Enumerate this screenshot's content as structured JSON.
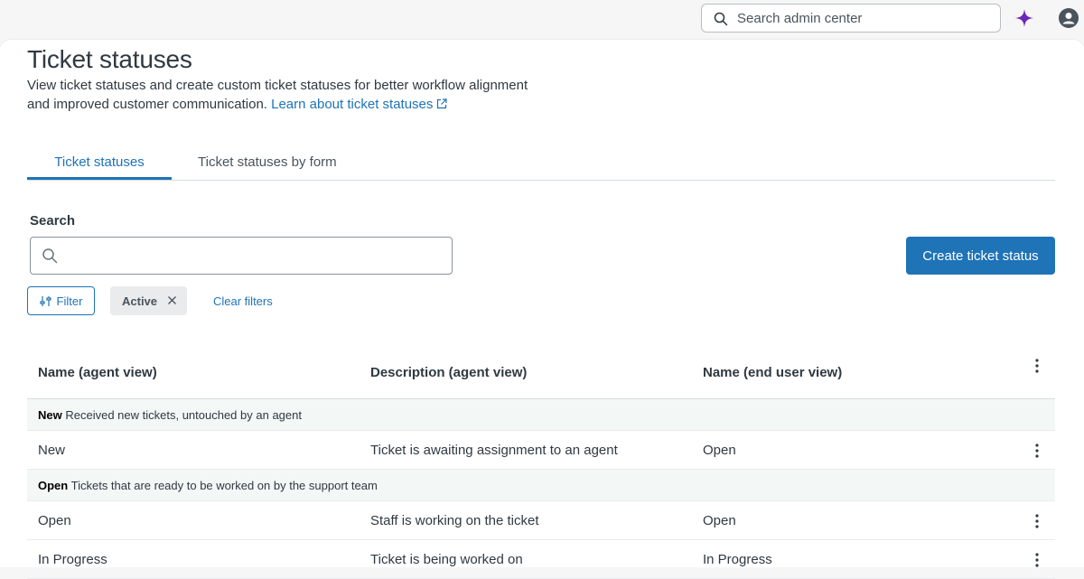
{
  "topbar": {
    "search_placeholder": "Search admin center",
    "icons": [
      "search-icon",
      "ai-sparkle-icon",
      "avatar-icon"
    ],
    "ai_color": "#6a27b8"
  },
  "page": {
    "title": "Ticket statuses",
    "description_line1": "View ticket statuses and create custom ticket statuses for better workflow alignment",
    "description_line2": "and improved customer communication.",
    "learn_link": "Learn about ticket statuses"
  },
  "tabs": [
    {
      "label": "Ticket statuses",
      "active": true
    },
    {
      "label": "Ticket statuses by form",
      "active": false
    }
  ],
  "search": {
    "label": "Search",
    "value": ""
  },
  "create_button": "Create ticket status",
  "filters": {
    "filter_label": "Filter",
    "active_chip": "Active",
    "clear_label": "Clear filters"
  },
  "table": {
    "headers": [
      "Name (agent view)",
      "Description (agent view)",
      "Name (end user view)"
    ],
    "groups": [
      {
        "name": "New",
        "description": "Received new tickets, untouched by an agent",
        "rows": [
          {
            "name": "New",
            "description": "Ticket is awaiting assignment to an agent",
            "end_user": "Open"
          }
        ]
      },
      {
        "name": "Open",
        "description": "Tickets that are ready to be worked on by the support team",
        "rows": [
          {
            "name": "Open",
            "description": "Staff is working on the ticket",
            "end_user": "Open"
          },
          {
            "name": "In Progress",
            "description": "Ticket is being worked on",
            "end_user": "In Progress"
          }
        ]
      }
    ]
  },
  "colors": {
    "accent": "#1f73b7",
    "text": "#2f3941",
    "group_bg": "#f3f7f6"
  }
}
